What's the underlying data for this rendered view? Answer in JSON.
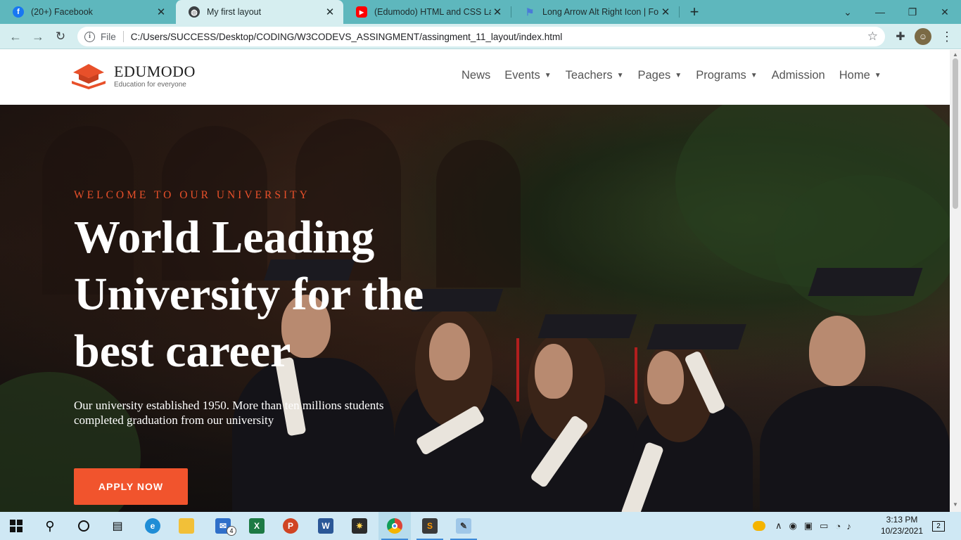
{
  "browser": {
    "tabs": [
      {
        "title": "(20+) Facebook",
        "favicon": "facebook-icon",
        "color": "#1877f2"
      },
      {
        "title": "My first layout",
        "favicon": "globe-icon",
        "color": "#3c4043"
      },
      {
        "title": "(Edumodo) HTML and CSS Layou",
        "favicon": "youtube-icon",
        "color": "#ff0000"
      },
      {
        "title": "Long Arrow Alt Right Icon | Font",
        "favicon": "flag-icon",
        "color": "#4a7ad8"
      }
    ],
    "new_tab": "+",
    "address": {
      "scheme": "File",
      "url": "C:/Users/SUCCESS/Desktop/CODING/W3CODEVS_ASSINGMENT/assingment_11_layout/index.html"
    }
  },
  "site": {
    "brand": "EDUMODO",
    "tagline": "Education for everyone",
    "nav": [
      {
        "label": "News",
        "dropdown": false
      },
      {
        "label": "Events",
        "dropdown": true
      },
      {
        "label": "Teachers",
        "dropdown": true
      },
      {
        "label": "Pages",
        "dropdown": true
      },
      {
        "label": "Programs",
        "dropdown": true
      },
      {
        "label": "Admission",
        "dropdown": false
      },
      {
        "label": "Home",
        "dropdown": true
      }
    ],
    "accent": "#f1542d"
  },
  "hero": {
    "kicker": "WELCOME TO OUR UNIVERSITY",
    "headline_lines": [
      "World Leading",
      "University for the",
      "best career"
    ],
    "lead": "Our university established 1950. More than ten millions students completed graduation from our university",
    "cta": "APPLY NOW"
  },
  "taskbar": {
    "mail_badge": "4",
    "time": "3:13 PM",
    "date": "10/23/2021",
    "notifications": "2"
  }
}
